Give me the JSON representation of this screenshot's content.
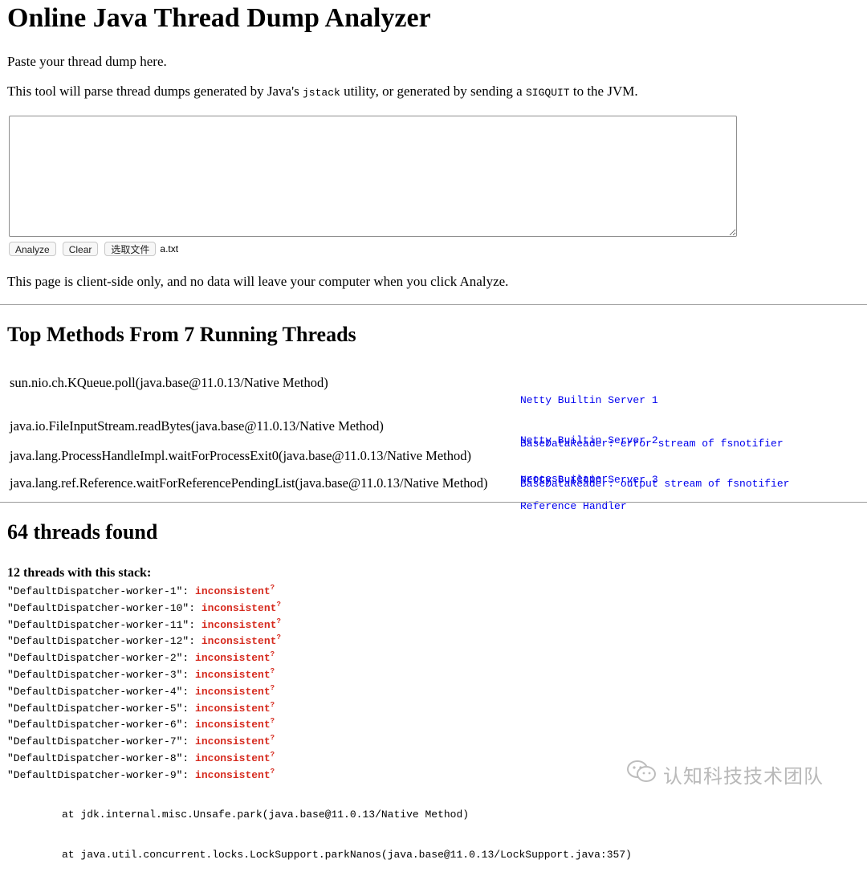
{
  "header": {
    "title": "Online Java Thread Dump Analyzer",
    "paste_prompt": "Paste your thread dump here.",
    "intro_prefix": "This tool will parse thread dumps generated by Java's ",
    "intro_code1": "jstack",
    "intro_middle": " utility, or generated by sending a ",
    "intro_code2": "SIGQUIT",
    "intro_suffix": " to the JVM."
  },
  "input": {
    "textarea_value": ""
  },
  "buttons": {
    "analyze": "Analyze",
    "clear": "Clear",
    "choose_file": "选取文件",
    "chosen_file": "a.txt"
  },
  "privacy_note": "This page is client-side only, and no data will leave your computer when you click Analyze.",
  "top_methods": {
    "heading": "Top Methods From 7 Running Threads",
    "rows": [
      {
        "method": "sun.nio.ch.KQueue.poll(java.base@11.0.13/Native Method)",
        "threads": [
          "Netty Builtin Server 1",
          "Netty Builtin Server 2",
          "Netty Builtin Server 3"
        ]
      },
      {
        "method": "java.io.FileInputStream.readBytes(java.base@11.0.13/Native Method)",
        "threads": [
          "BaseDataReader: error stream of fsnotifier",
          "BaseDataReader: output stream of fsnotifier"
        ]
      },
      {
        "method": "java.lang.ProcessHandleImpl.waitForProcessExit0(java.base@11.0.13/Native Method)",
        "threads": [
          "process reaper"
        ]
      },
      {
        "method": "java.lang.ref.Reference.waitForReferencePendingList(java.base@11.0.13/Native Method)",
        "threads": [
          "Reference Handler"
        ]
      }
    ]
  },
  "threads_found": {
    "heading": "64 threads found",
    "group_heading": "12 threads with this stack:",
    "threads": [
      {
        "name": "\"DefaultDispatcher-worker-1\": ",
        "state": "inconsistent"
      },
      {
        "name": "\"DefaultDispatcher-worker-10\": ",
        "state": "inconsistent"
      },
      {
        "name": "\"DefaultDispatcher-worker-11\": ",
        "state": "inconsistent"
      },
      {
        "name": "\"DefaultDispatcher-worker-12\": ",
        "state": "inconsistent"
      },
      {
        "name": "\"DefaultDispatcher-worker-2\": ",
        "state": "inconsistent"
      },
      {
        "name": "\"DefaultDispatcher-worker-3\": ",
        "state": "inconsistent"
      },
      {
        "name": "\"DefaultDispatcher-worker-4\": ",
        "state": "inconsistent"
      },
      {
        "name": "\"DefaultDispatcher-worker-5\": ",
        "state": "inconsistent"
      },
      {
        "name": "\"DefaultDispatcher-worker-6\": ",
        "state": "inconsistent"
      },
      {
        "name": "\"DefaultDispatcher-worker-7\": ",
        "state": "inconsistent"
      },
      {
        "name": "\"DefaultDispatcher-worker-8\": ",
        "state": "inconsistent"
      },
      {
        "name": "\"DefaultDispatcher-worker-9\": ",
        "state": "inconsistent"
      }
    ],
    "state_help_marker": "?",
    "stack_frames": [
      "at jdk.internal.misc.Unsafe.park(java.base@11.0.13/Native Method)",
      "at java.util.concurrent.locks.LockSupport.parkNanos(java.base@11.0.13/LockSupport.java:357)"
    ]
  },
  "watermark": {
    "text": "认知科技技术团队",
    "icon": "wechat-icon"
  },
  "colors": {
    "link": "#0000ee",
    "state": "#d62b1f",
    "rule": "#999999",
    "watermark": "#b9b9b9"
  }
}
